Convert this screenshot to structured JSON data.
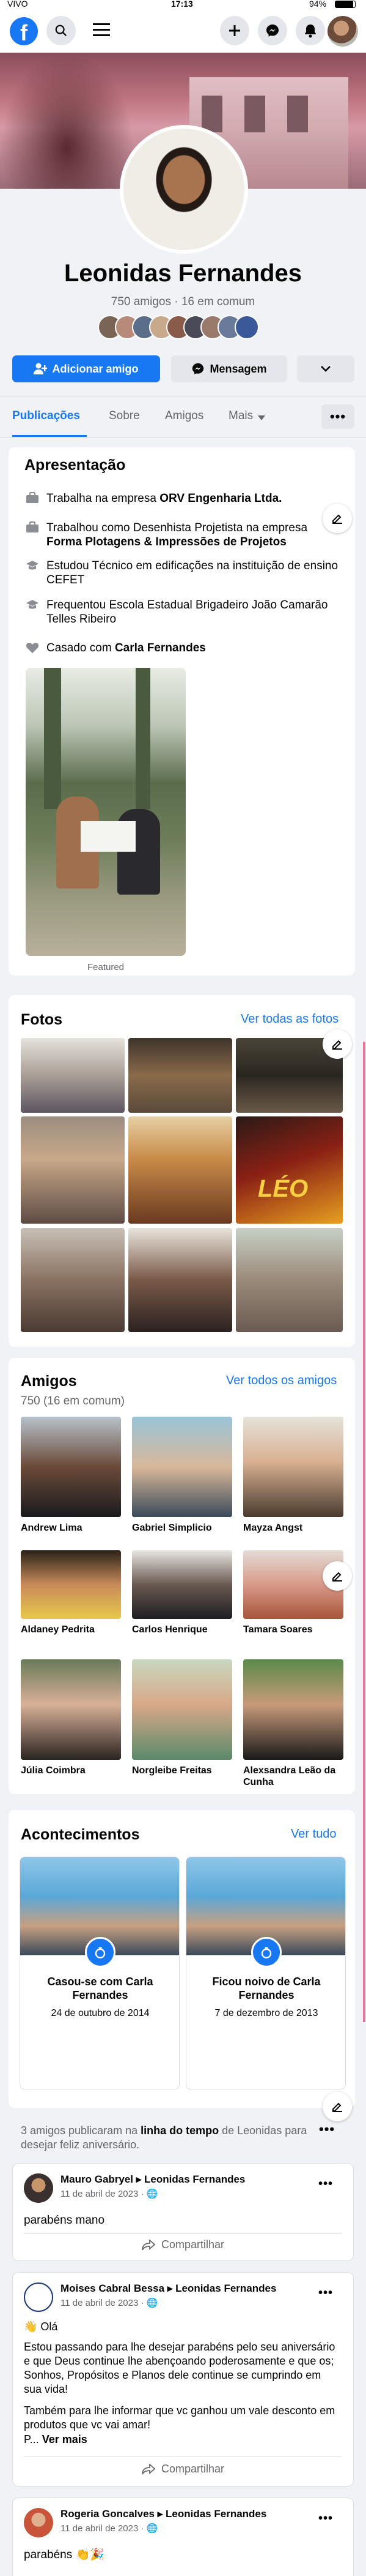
{
  "status_bar": {
    "carrier": "VIVO",
    "time": "17:13",
    "battery": "94%"
  },
  "header": {
    "logo": "f"
  },
  "profile": {
    "name": "Leonidas Fernandes",
    "subline": "750 amigos · 16 em comum",
    "add_friend": "Adicionar amigo",
    "message": "Mensagem"
  },
  "tabs": [
    "Publicações",
    "Sobre",
    "Amigos",
    "Mais"
  ],
  "intro": {
    "items": [
      {
        "pre": "Trabalha na empresa ",
        "bold": "ORV Engenharia Ltda.",
        "icon": "briefcase-icon"
      },
      {
        "pre": "Trabalhou como Desenhista Projetista na empresa ",
        "bold": "Forma Plotagens & Impressões de Projetos",
        "icon": "briefcase-icon"
      },
      {
        "pre": "Estudou Técnico em edificações na instituição de ensino CEFET",
        "bold": "",
        "icon": "graduation-cap-icon"
      },
      {
        "pre": "Frequentou Escola Estadual Brigadeiro João Camarão Telles Ribeiro",
        "bold": "",
        "icon": "graduation-cap-icon"
      },
      {
        "pre": "Casado com ",
        "bold": "Carla Fernandes",
        "icon": "heart-icon"
      }
    ],
    "featured_label": "Featured"
  },
  "apresentacao": {
    "title": "Apresentação"
  },
  "fotos": {
    "title": "Fotos",
    "see_all": "Ver todas as fotos",
    "poster_text": "LÉO"
  },
  "amigos": {
    "title": "Amigos",
    "count": "750 (16 em comum)",
    "see_all": "Ver todos os amigos",
    "friends": [
      "Andrew Lima",
      "Gabriel Simplicio",
      "Mayza Angst",
      "Aldaney Pedrita",
      "Carlos Henrique",
      "Tamara Soares",
      "Júlia Coimbra",
      "Norgleibe Freitas",
      "Alexsandra Leão da Cunha"
    ]
  },
  "acontecimentos": {
    "title": "Acontecimentos",
    "see_all": "Ver tudo",
    "events": [
      {
        "title": "Casou-se com Carla Fernandes",
        "date": "24 de outubro de 2014"
      },
      {
        "title": "Ficou noivo de Carla Fernandes",
        "date": "7 de dezembro de 2013"
      }
    ]
  },
  "timeline_note": {
    "pre": "3 amigos publicaram na ",
    "bold": "linha do tempo",
    "post": " de Leonidas para desejar feliz aniversário."
  },
  "posts": [
    {
      "author": "Mauro Gabryel",
      "target": "Leonidas Fernandes",
      "date": "11 de abril de 2023 · ",
      "text": "parabéns mano",
      "share": "Compartilhar"
    },
    {
      "author": "Moises Cabral Bessa",
      "target": "Leonidas Fernandes",
      "date": "11 de abril de 2023 · ",
      "greeting": "Olá",
      "p1": "Estou passando para lhe desejar parabéns pelo seu aniversário e que Deus continue lhe abençoando poderosamente e que os; Sonhos, Propósitos e Planos dele continue se cumprindo em sua vida!",
      "p2": "Também para lhe informar que vc ganhou um vale desconto em produtos que vc vai amar!",
      "more_pre": "P... ",
      "more": "Ver mais",
      "share": "Compartilhar"
    },
    {
      "author": "Rogeria Goncalves",
      "target": "Leonidas Fernandes",
      "date": "11 de abril de 2023 · ",
      "text": "parabéns"
    }
  ],
  "colors": {
    "brand": "#1877f2",
    "background": "#f0f2f5"
  }
}
